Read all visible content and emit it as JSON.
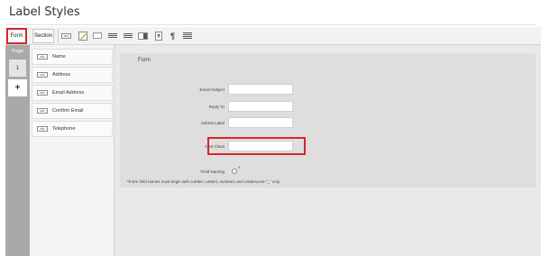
{
  "page_title": "Label Styles",
  "toolbar": {
    "form_label": "Form",
    "section_label": "Section",
    "icons": [
      "abc-text-icon",
      "edit-pencil-icon",
      "textbox-icon",
      "list-icon",
      "checklist-icon",
      "dropdown-icon",
      "file-upload-icon",
      "paragraph-icon",
      "textarea-icon"
    ],
    "paragraph_glyph": "¶",
    "abc_glyph": "ABC"
  },
  "pages": {
    "label": "Page",
    "current": "1",
    "add_glyph": "+"
  },
  "fields": [
    {
      "chip": "ABC",
      "label": "Name"
    },
    {
      "chip": "ABC",
      "label": "Address"
    },
    {
      "chip": "ABC",
      "label": "Email Address"
    },
    {
      "chip": "ABC",
      "label": "Confirm Email"
    },
    {
      "chip": "ABC",
      "label": "Telephone"
    }
  ],
  "form_panel": {
    "title": "Form",
    "rows": [
      {
        "label": "Email Subject",
        "value": ""
      },
      {
        "label": "Reply To",
        "value": ""
      },
      {
        "label": "Submit Label",
        "value": ""
      },
      {
        "label": "CSS Class",
        "value": ""
      }
    ],
    "field_naming_label": "Field Naming",
    "field_naming_star": "*",
    "note": "*Form field names must begin with a letter. Letters, numbers and underscore \"_\" only."
  },
  "colors": {
    "highlight": "#d8262b",
    "page_column": "#a9a9a9"
  }
}
